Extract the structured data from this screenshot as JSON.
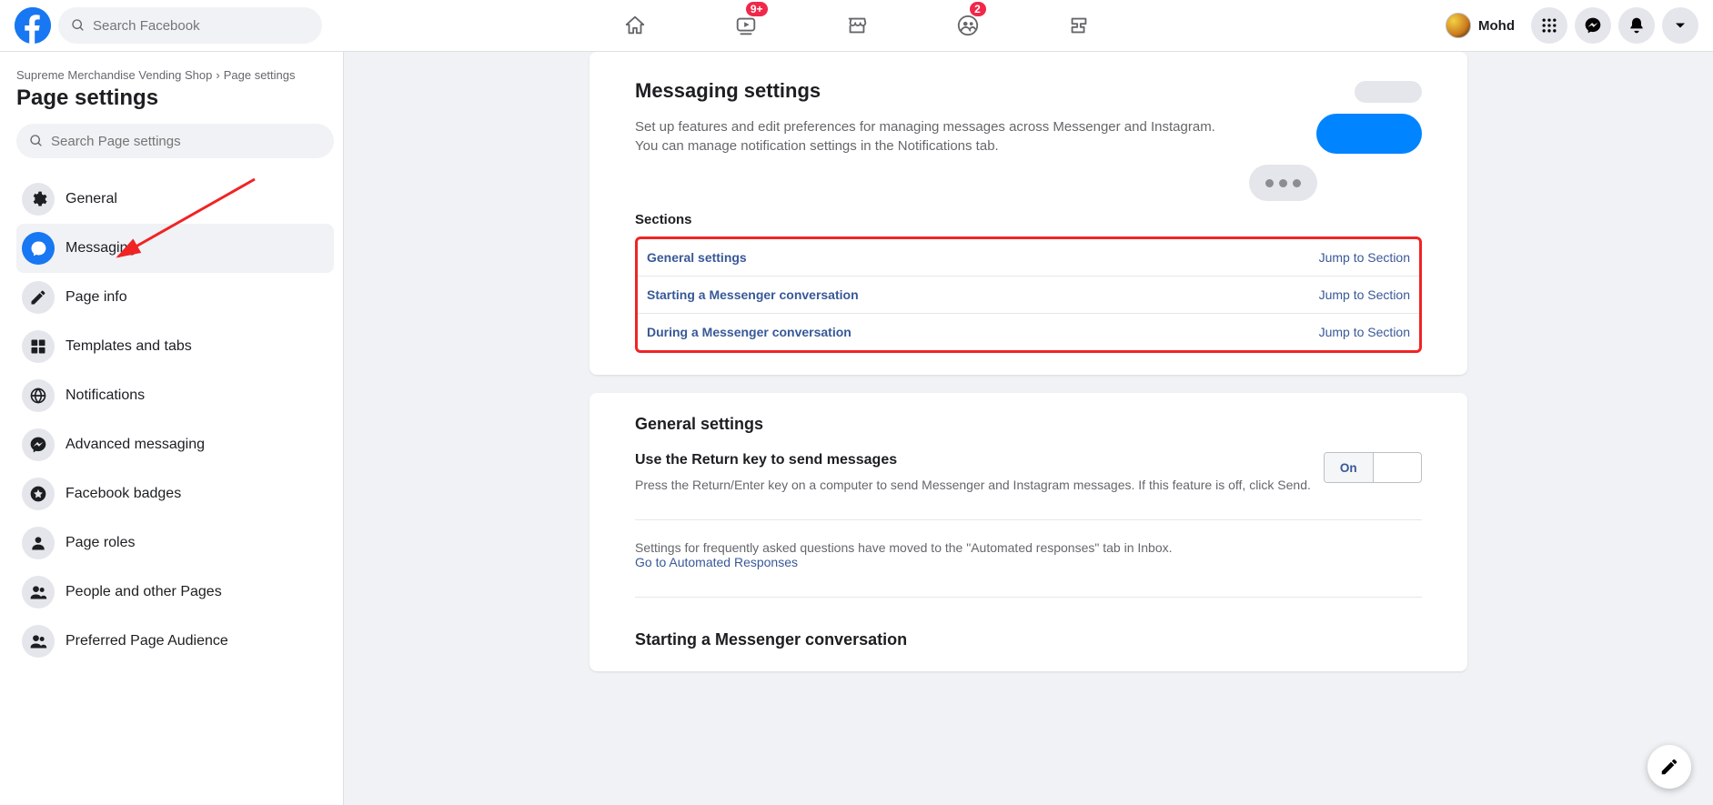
{
  "header": {
    "search_placeholder": "Search Facebook",
    "profile_name": "Mohd",
    "badges": {
      "watch": "9+",
      "groups": "2"
    }
  },
  "breadcrumb": {
    "page": "Supreme Merchandise Vending Shop",
    "current": "Page settings"
  },
  "page_title": "Page settings",
  "side_search_placeholder": "Search Page settings",
  "side_items": [
    {
      "label": "General"
    },
    {
      "label": "Messaging"
    },
    {
      "label": "Page info"
    },
    {
      "label": "Templates and tabs"
    },
    {
      "label": "Notifications"
    },
    {
      "label": "Advanced messaging"
    },
    {
      "label": "Facebook badges"
    },
    {
      "label": "Page roles"
    },
    {
      "label": "People and other Pages"
    },
    {
      "label": "Preferred Page Audience"
    }
  ],
  "content": {
    "title": "Messaging settings",
    "subtitle": "Set up features and edit preferences for managing messages across Messenger and Instagram. You can manage notification settings in the Notifications tab.",
    "sections_header": "Sections",
    "section_links": [
      {
        "label": "General settings",
        "jump": "Jump to Section"
      },
      {
        "label": "Starting a Messenger conversation",
        "jump": "Jump to Section"
      },
      {
        "label": "During a Messenger conversation",
        "jump": "Jump to Section"
      }
    ],
    "general_heading": "General settings",
    "return_title": "Use the Return key to send messages",
    "return_desc": "Press the Return/Enter key on a computer to send Messenger and Instagram messages. If this feature is off, click Send.",
    "toggle_on": "On",
    "faq_text": "Settings for frequently asked questions have moved to the \"Automated responses\" tab in Inbox.",
    "faq_link": "Go to Automated Responses",
    "starting_heading": "Starting a Messenger conversation"
  }
}
